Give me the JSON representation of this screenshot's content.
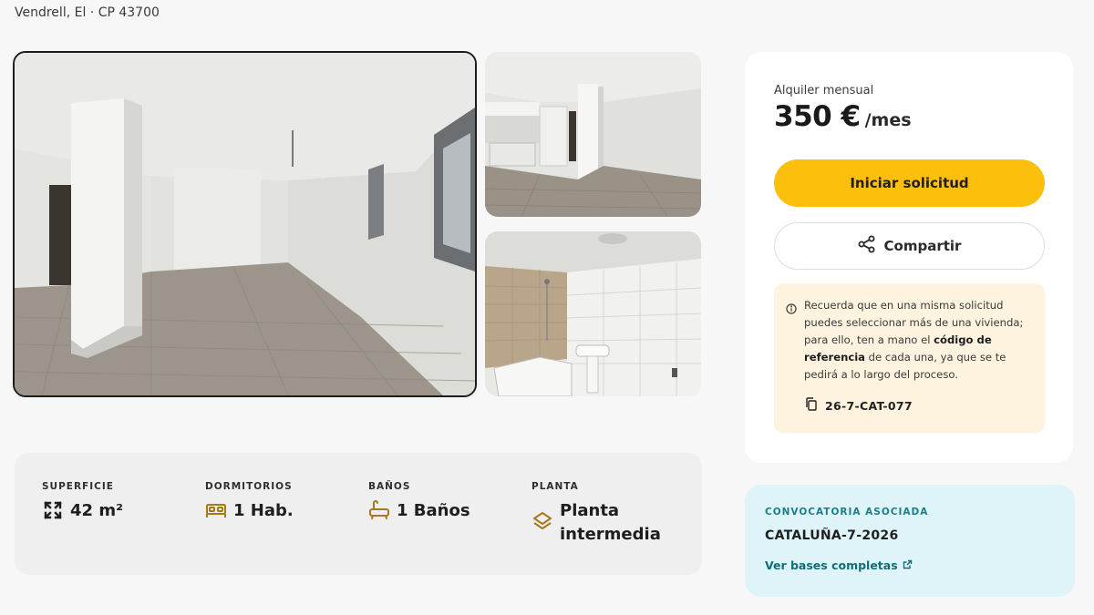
{
  "location": "Vendrell, El · CP 43700",
  "gallery": {
    "main_alt": "Open-plan living room with column, tiled floor and window",
    "kitchen_alt": "Kitchen area with white cabinets and column",
    "bath_alt": "Bathroom with bathtub, sink and tiled walls"
  },
  "specs": [
    {
      "title": "SUPERFICIE",
      "value": "42 m²",
      "icon": "expand-icon"
    },
    {
      "title": "DORMITORIOS",
      "value": "1 Hab.",
      "icon": "bed-icon"
    },
    {
      "title": "BAÑOS",
      "value": "1 Baños",
      "icon": "bathtub-icon"
    },
    {
      "title": "PLANTA",
      "value": "Planta intermedia",
      "icon": "layers-icon"
    }
  ],
  "price_card": {
    "label": "Alquiler mensual",
    "amount": "350 €",
    "unit": "/mes",
    "apply_label": "Iniciar solicitud",
    "share_label": "Compartir",
    "notice": {
      "before": "Recuerda que en una misma solicitud puedes seleccionar más de una vivienda; para ello, ten a mano el ",
      "bold": "código de referencia",
      "after": " de cada una, ya que se te pedirá a lo largo del proceso."
    },
    "reference_code": "26-7-CAT-077"
  },
  "convocatoria": {
    "title": "CONVOCATORIA ASOCIADA",
    "code": "CATALUÑA-7-2026",
    "link_label": "Ver bases completas"
  },
  "colors": {
    "accent": "#fcbf0c",
    "notice_bg": "#fdf3df",
    "conv_bg": "#def4f8",
    "conv_title": "#1b7e8a",
    "icon_gold": "#a8781c"
  }
}
